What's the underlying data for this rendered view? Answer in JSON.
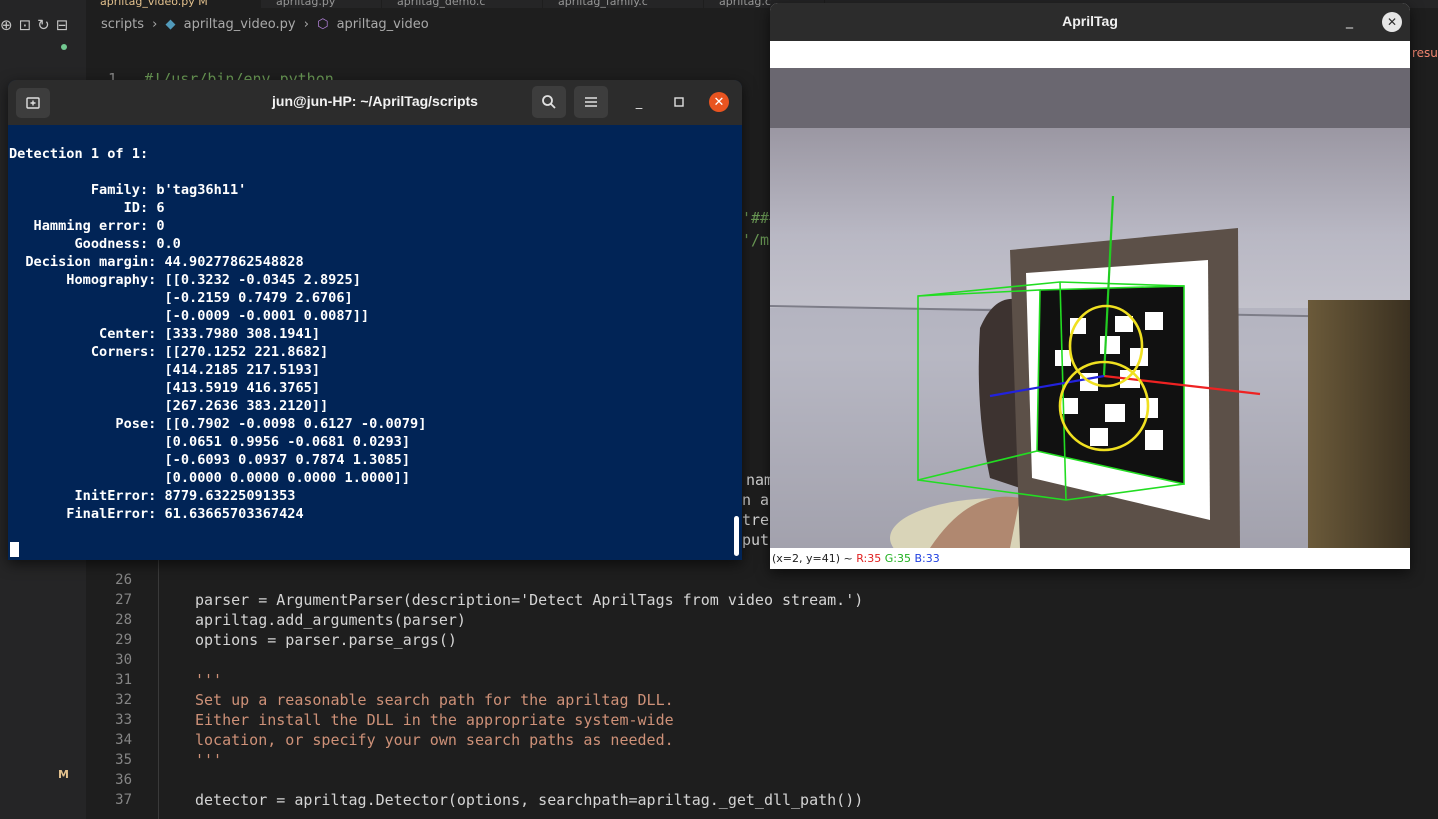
{
  "editor": {
    "tabs": [
      "apriltag_video.py M",
      "apriltag.py",
      "apriltag_demo.c",
      "apriltag_family.c",
      "apriltag.c"
    ],
    "breadcrumb": [
      "scripts",
      "apriltag_video.py",
      "apriltag_video"
    ],
    "first_line_number": "1",
    "first_line_text": "#!/usr/bin/env python",
    "git_badge": "M",
    "right_edge_text": "resu",
    "partial_fragments": [
      "'###",
      "'/mu",
      "nam",
      "n ar",
      "trea",
      "put)"
    ],
    "lines": [
      {
        "num": "26",
        "text": ""
      },
      {
        "num": "27",
        "text": "parser = ArgumentParser(description='Detect AprilTags from video stream.')"
      },
      {
        "num": "28",
        "text": "apriltag.add_arguments(parser)"
      },
      {
        "num": "29",
        "text": "options = parser.parse_args()"
      },
      {
        "num": "30",
        "text": ""
      },
      {
        "num": "31",
        "text": "'''"
      },
      {
        "num": "32",
        "text": "Set up a reasonable search path for the apriltag DLL."
      },
      {
        "num": "33",
        "text": "Either install the DLL in the appropriate system-wide"
      },
      {
        "num": "34",
        "text": "location, or specify your own search paths as needed."
      },
      {
        "num": "35",
        "text": "'''"
      },
      {
        "num": "36",
        "text": ""
      },
      {
        "num": "37",
        "text": "detector = apriltag.Detector(options, searchpath=apriltag._get_dll_path())"
      }
    ]
  },
  "terminal": {
    "title": "jun@jun-HP: ~/AprilTag/scripts",
    "output": "Detection 1 of 1:\n\n          Family: b'tag36h11'\n              ID: 6\n   Hamming error: 0\n        Goodness: 0.0\n  Decision margin: 44.90277862548828\n       Homography: [[0.3232 -0.0345 2.8925]\n                   [-0.2159 0.7479 2.6706]\n                   [-0.0009 -0.0001 0.0087]]\n           Center: [333.7980 308.1941]\n          Corners: [[270.1252 221.8682]\n                   [414.2185 217.5193]\n                   [413.5919 416.3765]\n                   [267.2636 383.2120]]\n             Pose: [[0.7902 -0.0098 0.6127 -0.0079]\n                   [0.0651 0.9956 -0.0681 0.0293]\n                   [-0.6093 0.0937 0.7874 1.3085]\n                   [0.0000 0.0000 0.0000 1.0000]]\n        InitError: 8779.63225091353\n       FinalError: 61.63665703367424",
    "detection": {
      "header": "Detection 1 of 1:",
      "family": "b'tag36h11'",
      "id": "6",
      "hamming_error": "0",
      "goodness": "0.0",
      "decision_margin": "44.90277862548828",
      "homography": [
        [
          "0.3232",
          "-0.0345",
          "2.8925"
        ],
        [
          "-0.2159",
          "0.7479",
          "2.6706"
        ],
        [
          "-0.0009",
          "-0.0001",
          "0.0087"
        ]
      ],
      "center": [
        "333.7980",
        "308.1941"
      ],
      "corners": [
        [
          "270.1252",
          "221.8682"
        ],
        [
          "414.2185",
          "217.5193"
        ],
        [
          "413.5919",
          "416.3765"
        ],
        [
          "267.2636",
          "383.2120"
        ]
      ],
      "pose": [
        [
          "0.7902",
          "-0.0098",
          "0.6127",
          "-0.0079"
        ],
        [
          "0.0651",
          "0.9956",
          "-0.0681",
          "0.0293"
        ],
        [
          "-0.6093",
          "0.0937",
          "0.7874",
          "1.3085"
        ],
        [
          "0.0000",
          "0.0000",
          "0.0000",
          "1.0000"
        ]
      ],
      "init_error": "8779.63225091353",
      "final_error": "61.63665703367424"
    }
  },
  "viewer": {
    "title": "AprilTag",
    "status_coords": "(x=2, y=41) ~",
    "status_r": "R:35",
    "status_g": "G:35",
    "status_b": "B:33"
  },
  "colors": {
    "terminal_bg": "#012456",
    "terminal_close": "#e95420",
    "box_green": "#22dd22",
    "axis_red": "#ee2222",
    "axis_blue": "#2222dd",
    "ellipse_yellow": "#f0e020"
  }
}
